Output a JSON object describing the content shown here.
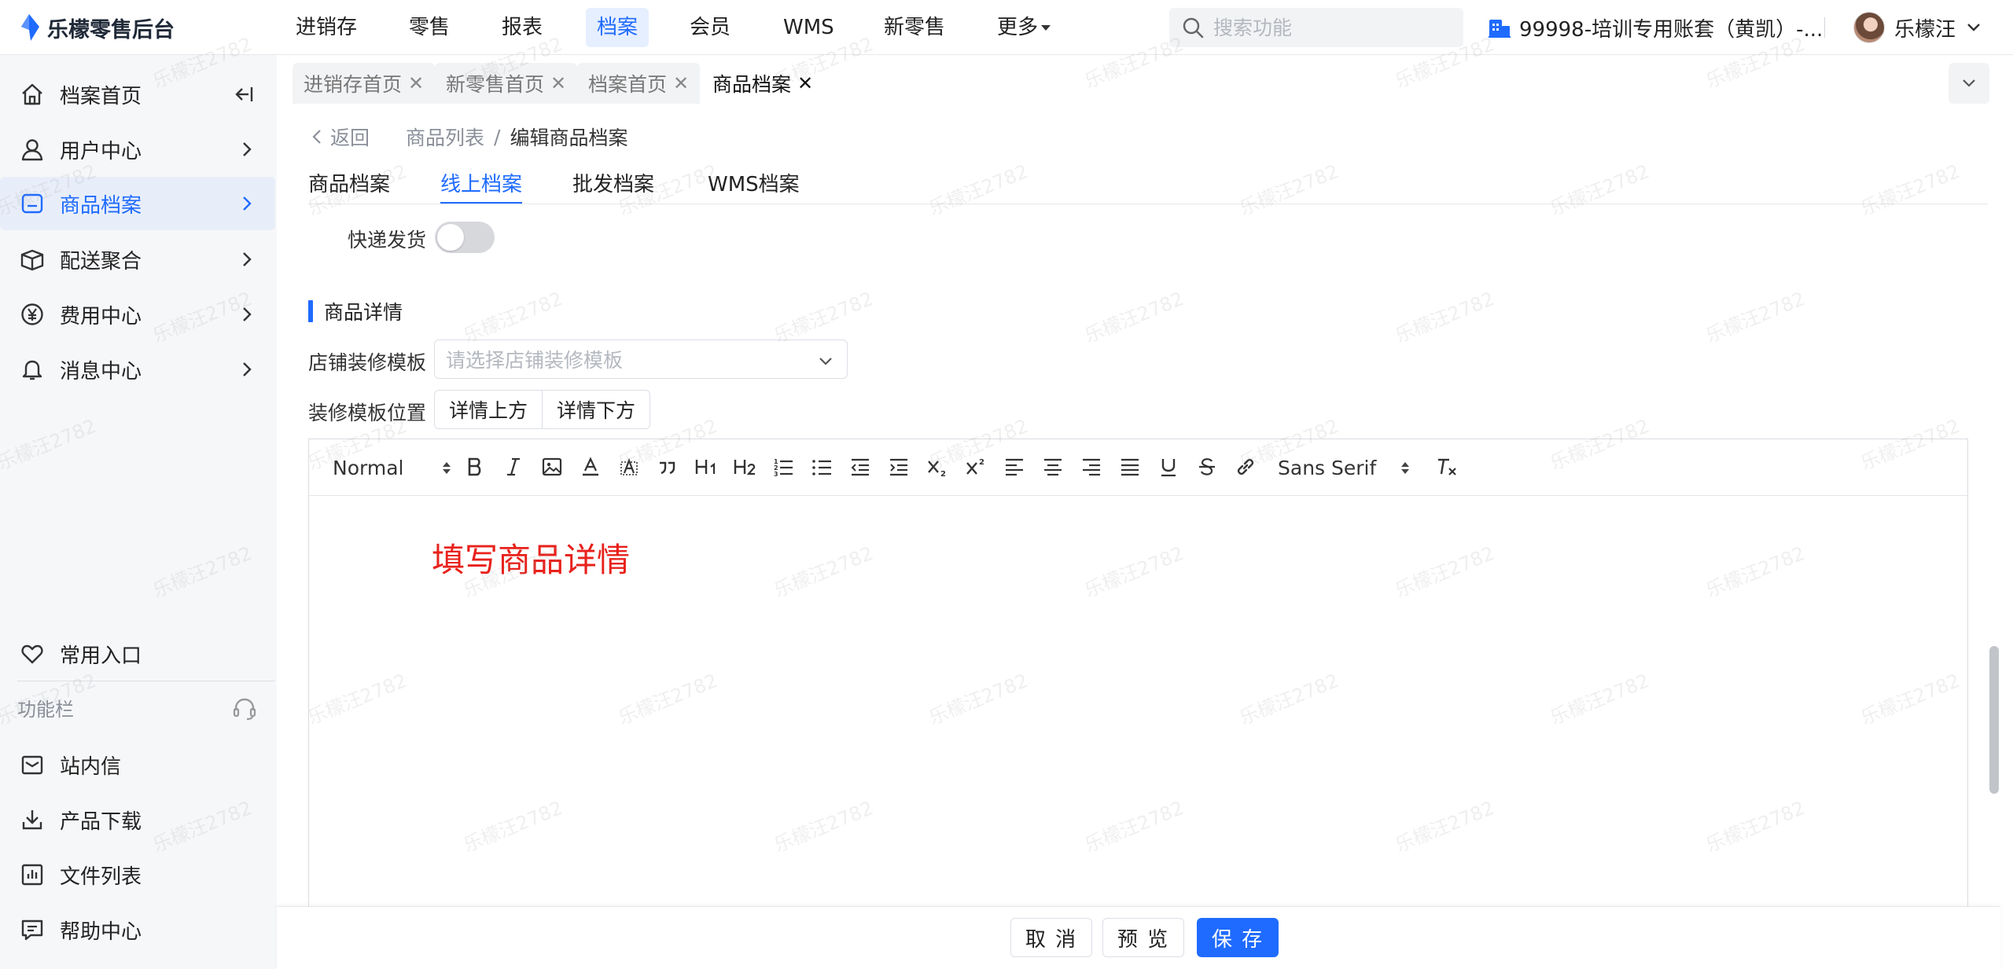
{
  "app": {
    "title": "乐檬零售后台"
  },
  "topnav": [
    {
      "label": "进销存",
      "active": false
    },
    {
      "label": "零售",
      "active": false
    },
    {
      "label": "报表",
      "active": false
    },
    {
      "label": "档案",
      "active": true
    },
    {
      "label": "会员",
      "active": false
    },
    {
      "label": "WMS",
      "active": false
    },
    {
      "label": "新零售",
      "active": false
    },
    {
      "label": "更多",
      "active": false
    }
  ],
  "search": {
    "placeholder": "搜索功能"
  },
  "account": {
    "label": "99998-培训专用账套（黄凯）-..."
  },
  "user": {
    "name": "乐檬汪"
  },
  "sidebar": {
    "items": [
      {
        "label": "档案首页"
      },
      {
        "label": "用户中心"
      },
      {
        "label": "商品档案",
        "active": true
      },
      {
        "label": "配送聚合"
      },
      {
        "label": "费用中心"
      },
      {
        "label": "消息中心"
      }
    ],
    "favorites": {
      "label": "常用入口"
    },
    "section": {
      "label": "功能栏"
    },
    "bottom": [
      {
        "label": "站内信"
      },
      {
        "label": "产品下载"
      },
      {
        "label": "文件列表"
      },
      {
        "label": "帮助中心"
      }
    ]
  },
  "tabs": [
    {
      "label": "进销存首页",
      "active": false
    },
    {
      "label": "新零售首页",
      "active": false
    },
    {
      "label": "档案首页",
      "active": false
    },
    {
      "label": "商品档案",
      "active": true
    }
  ],
  "breadcrumb": {
    "back": "返回",
    "parent": "商品列表",
    "separator": "/",
    "current": "编辑商品档案"
  },
  "subtabs": [
    {
      "label": "商品档案",
      "active": false
    },
    {
      "label": "线上档案",
      "active": true
    },
    {
      "label": "批发档案",
      "active": false
    },
    {
      "label": "WMS档案",
      "active": false
    }
  ],
  "form": {
    "express": {
      "label": "快递发货",
      "on": false
    },
    "detail_section": {
      "title": "商品详情"
    },
    "template": {
      "label": "店铺装修模板",
      "placeholder": "请选择店铺装修模板"
    },
    "position": {
      "label": "装修模板位置",
      "options": [
        "详情上方",
        "详情下方"
      ]
    }
  },
  "editor": {
    "format": "Normal",
    "font": "Sans Serif",
    "content": "填写商品详情",
    "content_color": "#e8211b"
  },
  "footer": {
    "cancel": "取 消",
    "preview": "预 览",
    "save": "保 存"
  },
  "watermark": "乐檬汪2782",
  "colors": {
    "accent": "#1f6bff",
    "sidebar_bg": "#f6f7f9",
    "active_bg": "#e8eef9"
  }
}
